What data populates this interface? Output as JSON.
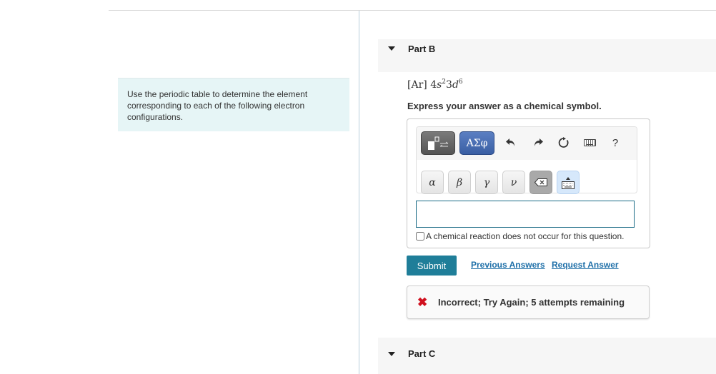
{
  "intro": {
    "text": "Use the periodic table to determine the element corresponding to each of the following electron configurations."
  },
  "part_b": {
    "title": "Part B",
    "formula": {
      "core": "[Ar]",
      "orbital1_n": "4",
      "orbital1_l": "s",
      "orbital1_e": "2",
      "orbital2_n": "3",
      "orbital2_l": "d",
      "orbital2_e": "6"
    },
    "instruction": "Express your answer as a chemical symbol.",
    "toolbar": {
      "template_icon": "templates-icon",
      "greek_label": "ΑΣφ",
      "undo_glyph": "↶",
      "redo_glyph": "↷",
      "reset_glyph": "↻",
      "help_label": "?"
    },
    "greek_keys": [
      "α",
      "β",
      "γ",
      "ν"
    ],
    "backspace_glyph": "⌫",
    "answer": {
      "value": "",
      "placeholder": ""
    },
    "no_reaction_label": "A chemical reaction does not occur for this question.",
    "no_reaction_checked": false,
    "submit_label": "Submit",
    "previous_answers_label": "Previous Answers",
    "request_answer_label": "Request Answer",
    "feedback": {
      "icon": "✖",
      "message": "Incorrect; Try Again; 5 attempts remaining",
      "color": "#d0101e"
    }
  },
  "part_c": {
    "title": "Part C"
  },
  "colors": {
    "accent": "#1f7e99",
    "link": "#1e6fa8",
    "intro_bg": "#e6f5f6",
    "greek_button": "#3a5fa4"
  }
}
